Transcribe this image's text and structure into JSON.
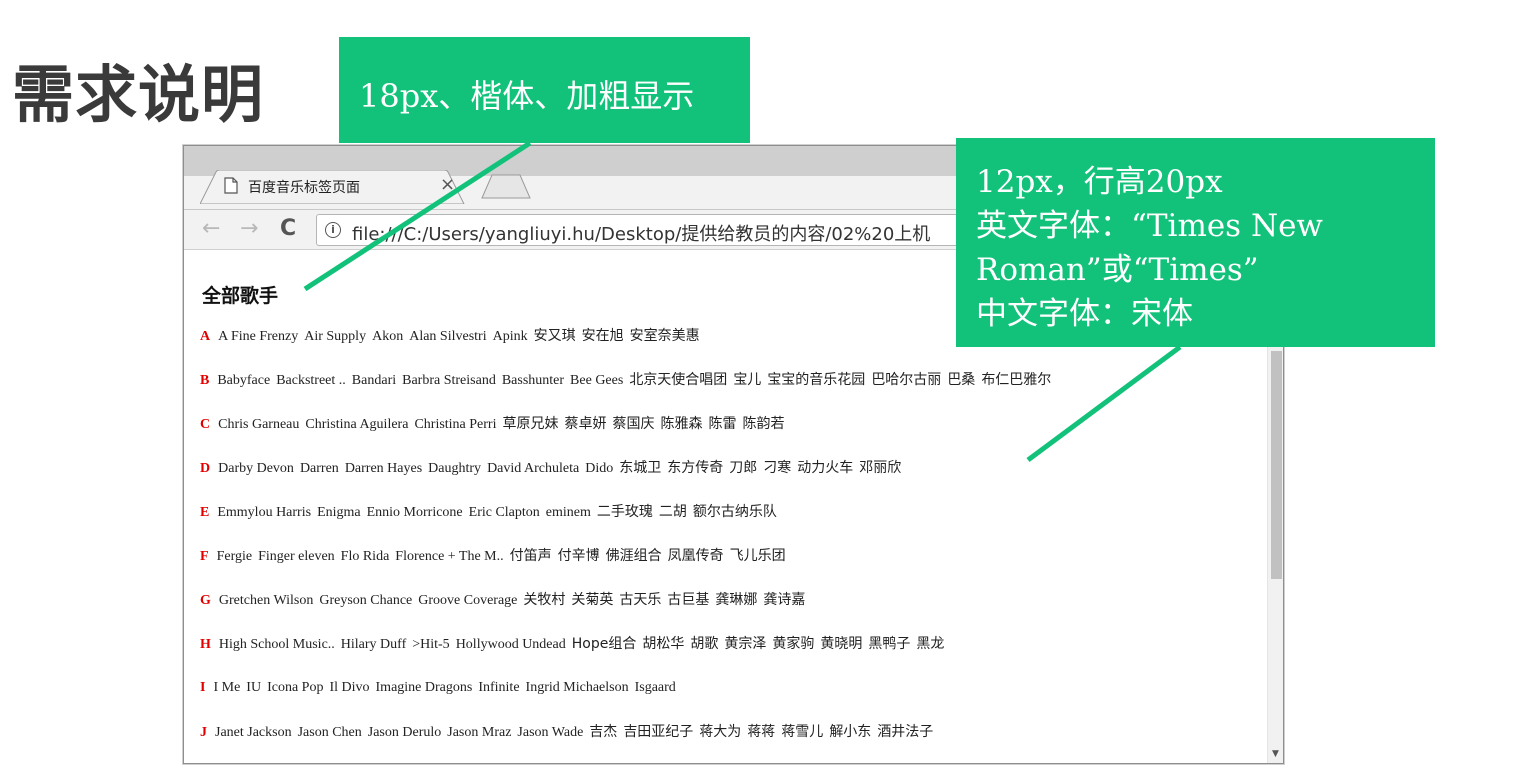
{
  "slide": {
    "title": "需求说明"
  },
  "callouts": {
    "top": "18px、楷体、加粗显示",
    "right_lines": [
      "12px，行高20px",
      "英文字体：“Times New",
      "Roman”或“Times”",
      "中文字体：宋体"
    ]
  },
  "browser": {
    "tab_title": "百度音乐标签页面",
    "tab_close": "×",
    "url": "file:///C:/Users/yangliuyi.hu/Desktop/提供给教员的内容/02%20上机",
    "nav": {
      "back": "←",
      "forward": "→",
      "reload": "C"
    }
  },
  "page": {
    "heading": "全部歌手",
    "rows": [
      {
        "letter": "A",
        "names": [
          "A Fine Frenzy",
          "Air Supply",
          "Akon",
          "Alan Silvestri",
          "Apink",
          "安又琪",
          "安在旭",
          "安室奈美惠"
        ]
      },
      {
        "letter": "B",
        "names": [
          "Babyface",
          "Backstreet ..",
          "Bandari",
          "Barbra Streisand",
          "Basshunter",
          "Bee Gees",
          "北京天使合唱团",
          "宝儿",
          "宝宝的音乐花园",
          "巴哈尔古丽",
          "巴桑",
          "布仁巴雅尔"
        ]
      },
      {
        "letter": "C",
        "names": [
          "Chris Garneau",
          "Christina Aguilera",
          "Christina Perri",
          "草原兄妹",
          "蔡卓妍",
          "蔡国庆",
          "陈雅森",
          "陈雷",
          "陈韵若"
        ]
      },
      {
        "letter": "D",
        "names": [
          "Darby Devon",
          "Darren",
          "Darren Hayes",
          "Daughtry",
          "David Archuleta",
          "Dido",
          "东城卫",
          "东方传奇",
          "刀郎",
          "刁寒",
          "动力火车",
          "邓丽欣"
        ]
      },
      {
        "letter": "E",
        "names": [
          "Emmylou Harris",
          "Enigma",
          "Ennio Morricone",
          "Eric Clapton",
          "eminem",
          "二手玫瑰",
          "二胡",
          "额尔古纳乐队"
        ]
      },
      {
        "letter": "F",
        "names": [
          "Fergie",
          "Finger eleven",
          "Flo Rida",
          "Florence + The M..",
          "付笛声",
          "付辛博",
          "佛涯组合",
          "凤凰传奇",
          "飞儿乐团"
        ]
      },
      {
        "letter": "G",
        "names": [
          "Gretchen Wilson",
          "Greyson Chance",
          "Groove Coverage",
          "关牧村",
          "关菊英",
          "古天乐",
          "古巨基",
          "龚琳娜",
          "龚诗嘉"
        ]
      },
      {
        "letter": "H",
        "names": [
          "High School Music..",
          "Hilary Duff",
          ">Hit-5",
          "Hollywood Undead",
          "Hope组合",
          "胡松华",
          "胡歌",
          "黄宗泽",
          "黄家驹",
          "黄晓明",
          "黑鸭子",
          "黑龙"
        ]
      },
      {
        "letter": "I",
        "names": [
          "I Me",
          "IU",
          "Icona Pop",
          "Il Divo",
          "Imagine Dragons",
          "Infinite",
          "Ingrid Michaelson",
          "Isgaard"
        ]
      },
      {
        "letter": "J",
        "names": [
          "Janet Jackson",
          "Jason Chen",
          "Jason Derulo",
          "Jason Mraz",
          "Jason Wade",
          "吉杰",
          "吉田亚纪子",
          "蒋大为",
          "蒋蒋",
          "蒋雪儿",
          "解小东",
          "酒井法子"
        ]
      }
    ]
  },
  "colors": {
    "callout": "#12c27a",
    "letter": "#e00000",
    "title": "#3a3a3a"
  },
  "icons": [
    "page-icon",
    "info-icon",
    "back-arrow-icon",
    "forward-arrow-icon",
    "reload-icon",
    "close-icon",
    "scroll-down-icon"
  ]
}
